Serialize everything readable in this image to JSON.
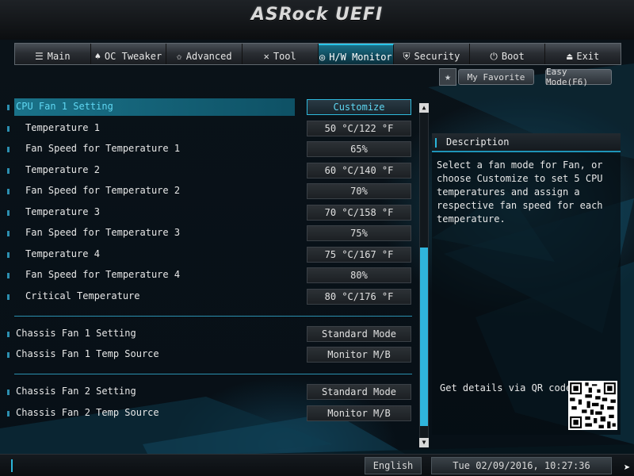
{
  "header": {
    "logo": "ASRock UEFI"
  },
  "tabs": [
    {
      "icon": "list-icon",
      "glyph": "☰",
      "label": "Main"
    },
    {
      "icon": "flame-icon",
      "glyph": "♠",
      "label": "OC Tweaker"
    },
    {
      "icon": "star-icon",
      "glyph": "✩",
      "label": "Advanced"
    },
    {
      "icon": "tools-icon",
      "glyph": "✕",
      "label": "Tool"
    },
    {
      "icon": "monitor-icon",
      "glyph": "◎",
      "label": "H/W Monitor",
      "active": true
    },
    {
      "icon": "shield-icon",
      "glyph": "⛨",
      "label": "Security"
    },
    {
      "icon": "power-icon",
      "glyph": "⏻",
      "label": "Boot"
    },
    {
      "icon": "exit-icon",
      "glyph": "⏏",
      "label": "Exit"
    }
  ],
  "toolbar": {
    "favorite_label": "My Favorite",
    "easy_mode_label": "Easy Mode(F6)"
  },
  "settings": [
    {
      "label": "CPU Fan 1 Setting",
      "value": "Customize",
      "selected": true,
      "sub": false
    },
    {
      "label": "Temperature 1",
      "value": "50 °C/122 °F",
      "sub": true
    },
    {
      "label": "Fan Speed for Temperature 1",
      "value": "65%",
      "sub": true
    },
    {
      "label": "Temperature 2",
      "value": "60 °C/140 °F",
      "sub": true
    },
    {
      "label": "Fan Speed for Temperature 2",
      "value": "70%",
      "sub": true
    },
    {
      "label": "Temperature 3",
      "value": "70 °C/158 °F",
      "sub": true
    },
    {
      "label": "Fan Speed for Temperature 3",
      "value": "75%",
      "sub": true
    },
    {
      "label": "Temperature 4",
      "value": "75 °C/167 °F",
      "sub": true
    },
    {
      "label": "Fan Speed for Temperature 4",
      "value": "80%",
      "sub": true
    },
    {
      "label": "Critical Temperature",
      "value": "80 °C/176 °F",
      "sub": true
    },
    {
      "label": "Chassis Fan 1 Setting",
      "value": "Standard Mode",
      "sub": false
    },
    {
      "label": "Chassis Fan 1 Temp Source",
      "value": "Monitor M/B",
      "sub": false
    },
    {
      "label": "Chassis Fan 2 Setting",
      "value": "Standard Mode",
      "sub": false
    },
    {
      "label": "Chassis Fan 2 Temp Source",
      "value": "Monitor M/B",
      "sub": false
    }
  ],
  "scrollbar": {
    "thumb_start_fraction": 0.42,
    "thumb_end_fraction": 0.94
  },
  "description": {
    "title": "Description",
    "text": "Select a fan mode for Fan, or choose Customize to set 5 CPU temperatures and assign a respective fan speed for each temperature.",
    "qr_label": "Get details via QR code"
  },
  "footer": {
    "language": "English",
    "datetime": "Tue 02/09/2016, 10:27:36"
  },
  "colors": {
    "accent": "#2bb5da",
    "highlight": "#1a7289",
    "selected_text": "#5fd7f2"
  }
}
